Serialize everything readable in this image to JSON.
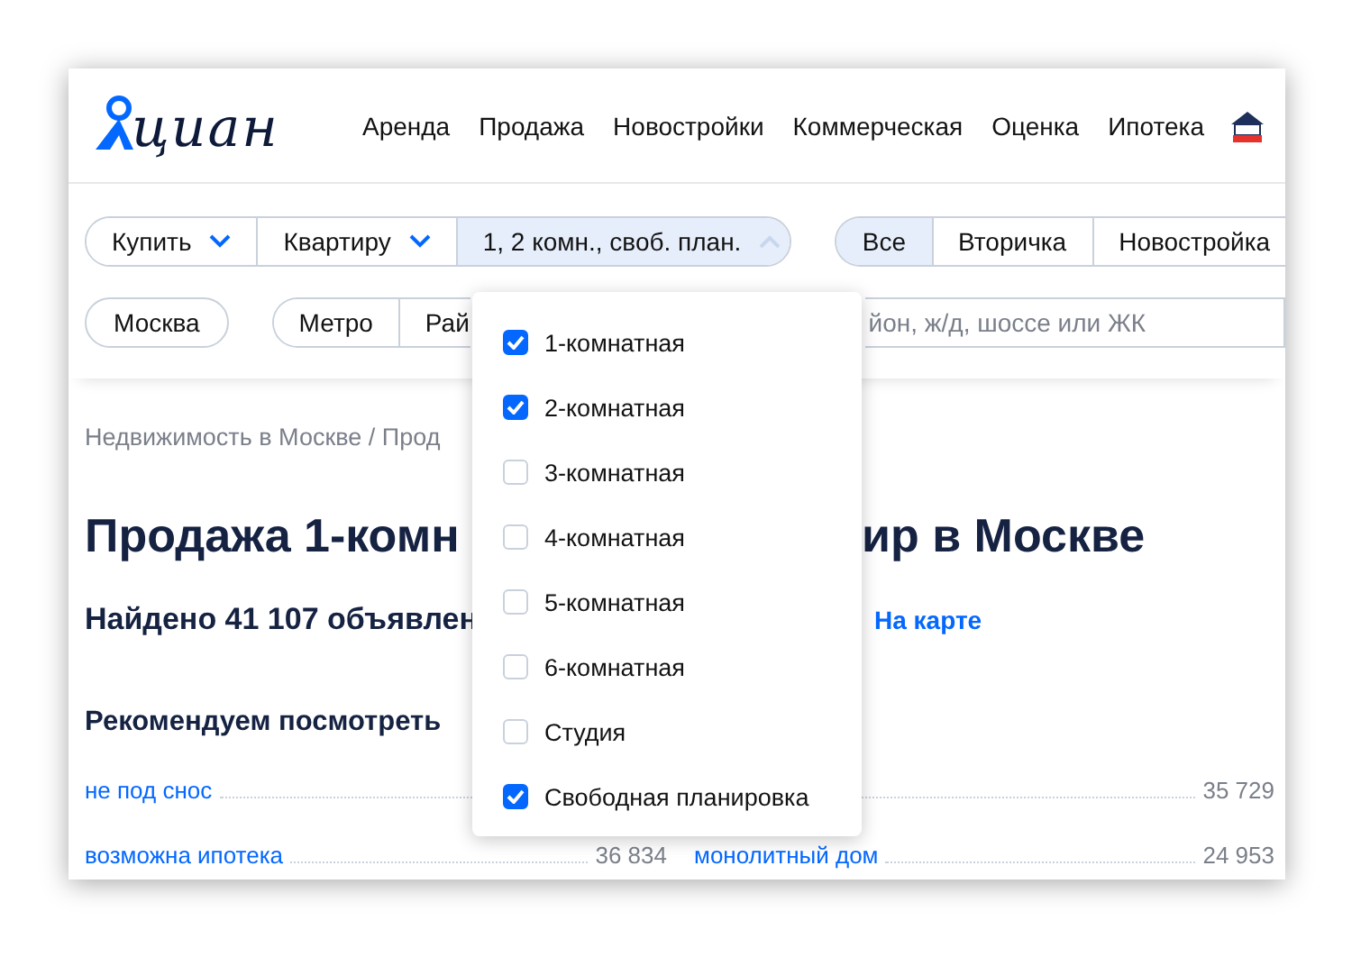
{
  "header": {
    "logo_text": "циан",
    "nav": [
      "Аренда",
      "Продажа",
      "Новостройки",
      "Коммерческая",
      "Оценка",
      "Ипотека"
    ]
  },
  "filters": {
    "deal": [
      {
        "label": "Купить",
        "expanded": false
      },
      {
        "label": "Квартиру",
        "expanded": false
      },
      {
        "label": "1, 2 комн., своб. план.",
        "expanded": true
      }
    ],
    "market_tabs": [
      {
        "label": "Все",
        "selected": true
      },
      {
        "label": "Вторичка",
        "selected": false
      },
      {
        "label": "Новостройка",
        "selected": false
      }
    ],
    "region": "Москва",
    "geo_tabs": [
      "Метро",
      "Рай"
    ],
    "search": {
      "placeholder": "йон, ж/д, шоссе или ЖК"
    }
  },
  "room_dropdown": [
    {
      "label": "1-комнатная",
      "checked": true
    },
    {
      "label": "2-комнатная",
      "checked": true
    },
    {
      "label": "3-комнатная",
      "checked": false
    },
    {
      "label": "4-комнатная",
      "checked": false
    },
    {
      "label": "5-комнатная",
      "checked": false
    },
    {
      "label": "6-комнатная",
      "checked": false
    },
    {
      "label": "Студия",
      "checked": false
    },
    {
      "label": "Свободная планировка",
      "checked": true
    }
  ],
  "breadcrumb": "Недвижимость в Москве / Прод",
  "heading": [
    "Продажа 1-комн",
    "ир в Москве"
  ],
  "found": "Найдено 41 107 объявлен",
  "map_link": "На карте",
  "recommend_title": "Рекомендуем посмотреть",
  "recommendations": [
    [
      {
        "label": "не под снос"
      },
      {
        "count": "35 729"
      }
    ],
    [
      {
        "label": "возможна ипотека",
        "count": "36 834"
      },
      {
        "label": "монолитный дом",
        "count": "24 953"
      }
    ]
  ]
}
